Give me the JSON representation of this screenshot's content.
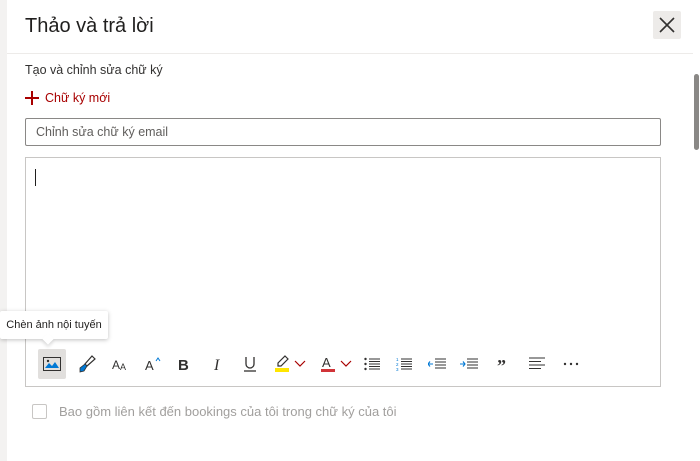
{
  "dialog": {
    "title": "Thảo và trả lời",
    "close_icon": "close-icon"
  },
  "signature": {
    "section_label": "Tạo và chỉnh sửa chữ ký",
    "new_signature_label": "Chữ ký mới",
    "name_input_placeholder": "Chỉnh sửa chữ ký email",
    "name_input_value": ""
  },
  "toolbar": {
    "items": [
      {
        "name": "insert-inline-image",
        "icon": "image-icon",
        "active": true
      },
      {
        "name": "format-painter",
        "icon": "paintbrush-icon"
      },
      {
        "name": "font-size",
        "icon": "font-size-icon"
      },
      {
        "name": "grow-font",
        "icon": "grow-font-icon"
      },
      {
        "name": "bold",
        "icon": "bold-icon"
      },
      {
        "name": "italic",
        "icon": "italic-icon"
      },
      {
        "name": "underline",
        "icon": "underline-icon"
      },
      {
        "name": "highlight",
        "icon": "highlighter-icon"
      },
      {
        "name": "font-color",
        "icon": "font-color-icon"
      },
      {
        "name": "bullets",
        "icon": "bullets-icon"
      },
      {
        "name": "numbering",
        "icon": "numbering-icon"
      },
      {
        "name": "decrease-indent",
        "icon": "decrease-indent-icon"
      },
      {
        "name": "increase-indent",
        "icon": "increase-indent-icon"
      },
      {
        "name": "quote",
        "icon": "quote-icon"
      },
      {
        "name": "align",
        "icon": "align-left-icon"
      },
      {
        "name": "more",
        "icon": "more-icon"
      }
    ],
    "tooltip": "Chèn ảnh nội tuyến"
  },
  "bookings": {
    "label": "Bao gồm liên kết đến bookings của tôi trong chữ ký của tôi",
    "checked": false
  },
  "colors": {
    "accent_red": "#a80000",
    "highlight_yellow": "#ffe600",
    "font_color_red": "#d13438",
    "link_blue": "#0078d4"
  }
}
